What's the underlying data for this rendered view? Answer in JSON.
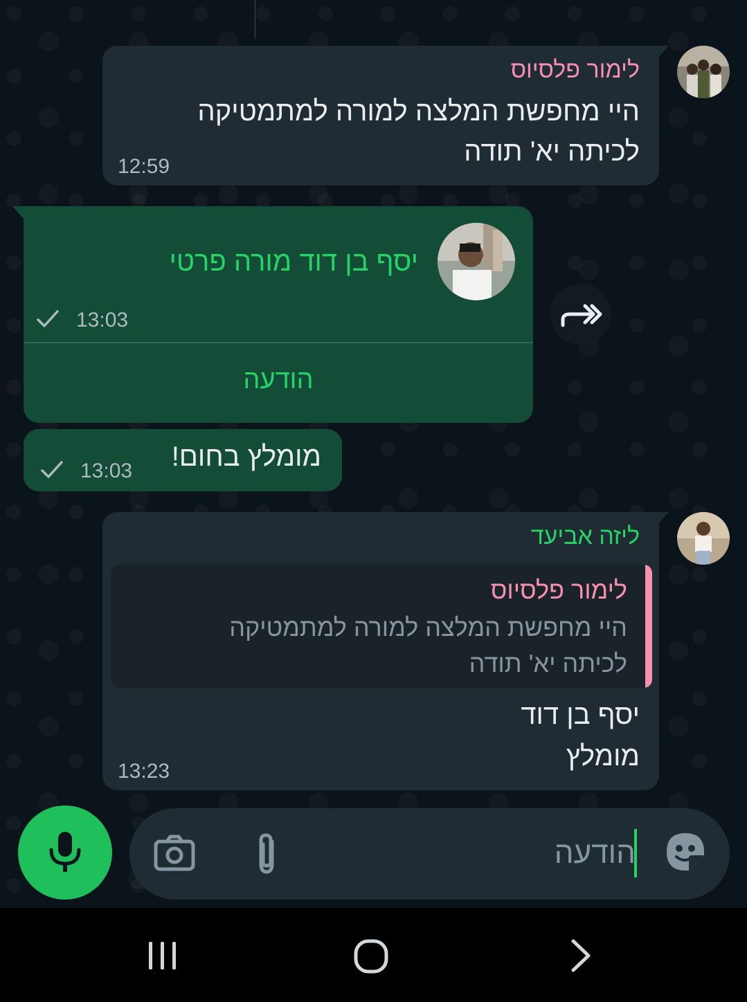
{
  "messages": [
    {
      "sender": "לימור פלסיוס",
      "sender_color": "#f78fb3",
      "text_line1": "היי מחפשת המלצה למורה למתמטיקה",
      "text_line2": "לכיתה יא' תודה",
      "time": "12:59"
    },
    {
      "contact_card_name": "יסף בן דוד מורה פרטי",
      "contact_name_color": "#25d366",
      "time": "13:03",
      "action_label": "הודעה"
    },
    {
      "text": "מומלץ בחום!",
      "time": "13:03"
    },
    {
      "sender": "ליזה אביעד",
      "sender_color": "#25d366",
      "quote_sender": "לימור פלסיוס",
      "quote_line1": "היי מחפשת המלצה למורה למתמטיקה",
      "quote_line2": "לכיתה יא' תודה",
      "text_line1": "יסף בן דוד",
      "text_line2": "מומלץ",
      "time": "13:23"
    }
  ],
  "composer": {
    "placeholder": "הודעה"
  },
  "colors": {
    "accent": "#1fc05b",
    "outgoing": "#134d37",
    "incoming": "#202c33"
  },
  "icons": [
    "microphone-icon",
    "camera-icon",
    "attach-icon",
    "sticker-icon",
    "forward-icon",
    "check-icon",
    "recents-icon",
    "home-icon",
    "back-icon"
  ]
}
